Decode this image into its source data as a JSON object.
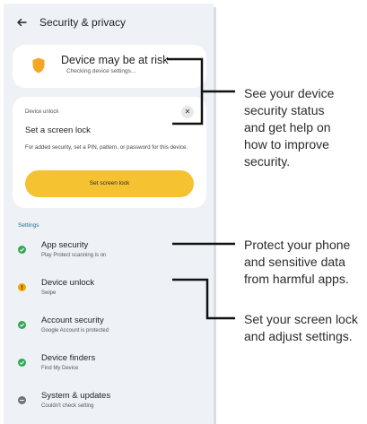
{
  "header": {
    "title": "Security & privacy"
  },
  "risk_card": {
    "title": "Device may be at risk",
    "subtitle": "Checking device settings..."
  },
  "unlock_card": {
    "eyebrow": "Device unlock",
    "title": "Set a screen lock",
    "body": "For added security, set a PIN, pattern, or password for this device.",
    "button": "Set screen lock"
  },
  "settings": {
    "label": "Settings",
    "items": [
      {
        "title": "App security",
        "subtitle": "Play Protect scanning is on",
        "status": "ok"
      },
      {
        "title": "Device unlock",
        "subtitle": "Swipe",
        "status": "warning"
      },
      {
        "title": "Account security",
        "subtitle": "Google Account is protected",
        "status": "ok"
      },
      {
        "title": "Device finders",
        "subtitle": "Find My Device",
        "status": "ok"
      },
      {
        "title": "System & updates",
        "subtitle": "Couldn't check setting",
        "status": "unknown"
      }
    ]
  },
  "annotations": {
    "status": [
      "See your device",
      "security status",
      "and get help on",
      "how to improve",
      "security."
    ],
    "apps": [
      "Protect your phone",
      "and sensitive data",
      "from harmful apps."
    ],
    "lock": [
      "Set your screen lock",
      "and adjust settings."
    ]
  },
  "colors": {
    "ok": "#34a853",
    "warning": "#f4a300",
    "unknown": "#6f7378",
    "accent": "#f5c232",
    "shield": "#f5a623"
  }
}
